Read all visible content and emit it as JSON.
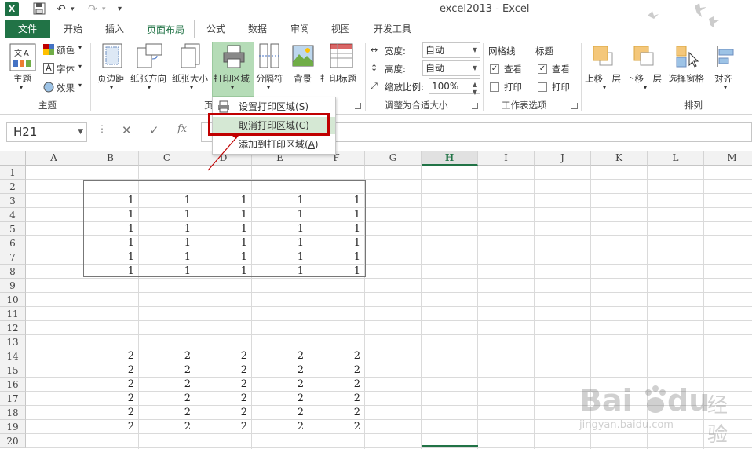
{
  "window": {
    "title": "excel2013 - Excel"
  },
  "tabs": [
    {
      "label": "文件"
    },
    {
      "label": "开始"
    },
    {
      "label": "插入"
    },
    {
      "label": "页面布局"
    },
    {
      "label": "公式"
    },
    {
      "label": "数据"
    },
    {
      "label": "审阅"
    },
    {
      "label": "视图"
    },
    {
      "label": "开发工具"
    }
  ],
  "ribbon": {
    "theme": {
      "themes": "主题",
      "colors": "颜色",
      "fonts": "字体",
      "effects": "效果",
      "group": "主题"
    },
    "page_setup": {
      "margins": "页边距",
      "orientation": "纸张方向",
      "size": "纸张大小",
      "print_area": "打印区域",
      "breaks": "分隔符",
      "background": "背景",
      "print_titles": "打印标题",
      "group": "页"
    },
    "scale": {
      "width_label": "宽度:",
      "width_value": "自动",
      "height_label": "高度:",
      "height_value": "自动",
      "scale_label": "缩放比例:",
      "scale_value": "100%",
      "group": "调整为合适大小"
    },
    "sheet_options": {
      "gridlines": "网格线",
      "headings": "标题",
      "view": "查看",
      "print": "打印",
      "group": "工作表选项"
    },
    "arrange": {
      "bring_forward": "上移一层",
      "send_backward": "下移一层",
      "selection_pane": "选择窗格",
      "align": "对齐",
      "group": "排列"
    }
  },
  "dropdown_menu": {
    "set_print_area": "设置打印区域",
    "set_key": "S",
    "clear_print_area": "取消打印区域",
    "clear_key": "C",
    "add_to_print_area": "添加到打印区域",
    "add_key": "A"
  },
  "formula_bar": {
    "name_box": "H21",
    "fx": "fx"
  },
  "columns": [
    "A",
    "B",
    "C",
    "D",
    "E",
    "F",
    "G",
    "H",
    "I",
    "J",
    "K",
    "L",
    "M"
  ],
  "selected_column": "H",
  "rows": [
    "1",
    "2",
    "3",
    "4",
    "5",
    "6",
    "7",
    "8",
    "9",
    "10",
    "11",
    "12",
    "13",
    "14",
    "15",
    "16",
    "17",
    "18",
    "19",
    "20"
  ],
  "cells": {
    "block1": {
      "rows": [
        3,
        4,
        5,
        6,
        7,
        8
      ],
      "cols": [
        "B",
        "C",
        "D",
        "E",
        "F"
      ],
      "value": "1"
    },
    "block2": {
      "rows": [
        14,
        15,
        16,
        17,
        18,
        19
      ],
      "cols": [
        "B",
        "C",
        "D",
        "E",
        "F"
      ],
      "value": "2"
    }
  },
  "watermark": {
    "brand": "Bai",
    "brand2": "du",
    "cn": "经验",
    "url": "jingyan.baidu.com"
  },
  "colors": {
    "excel_green": "#217346",
    "highlight_red": "#c00000"
  }
}
